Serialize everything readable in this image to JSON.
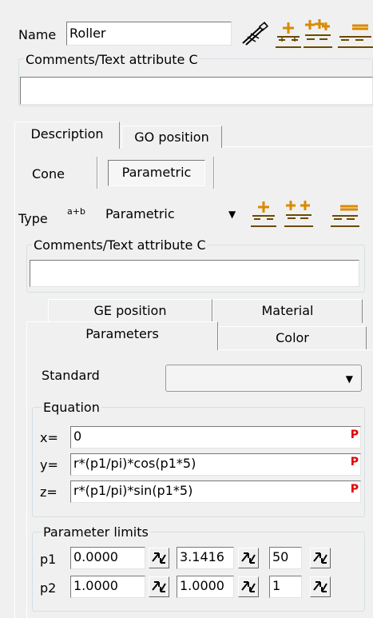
{
  "top": {
    "name_label": "Name",
    "name_value": "Roller",
    "comments_legend": "Comments/Text attribute C",
    "comments_value": ""
  },
  "tabs": [
    {
      "label": "Description",
      "active": true
    },
    {
      "label": "GO position",
      "active": false
    }
  ],
  "subtabs": [
    {
      "label": "Cone",
      "active": false
    },
    {
      "label": "Parametric",
      "active": true
    }
  ],
  "type_row": {
    "label": "Type",
    "badge": "a+b",
    "value": "Parametric"
  },
  "inner_comments": {
    "legend": "Comments/Text attribute C",
    "value": ""
  },
  "prop_tabs": {
    "row1": [
      "GE position",
      "Material"
    ],
    "row2": [
      "Parameters",
      "Color"
    ],
    "active": "Parameters"
  },
  "standard": {
    "label": "Standard",
    "value": ""
  },
  "equation": {
    "legend": "Equation",
    "marker": "P",
    "rows": [
      {
        "label": "x=",
        "value": "0"
      },
      {
        "label": "y=",
        "value": "r*(p1/pi)*cos(p1*5)"
      },
      {
        "label": "z=",
        "value": "r*(p1/pi)*sin(p1*5)"
      }
    ]
  },
  "limits": {
    "legend": "Parameter limits",
    "rows": [
      {
        "label": "p1",
        "min": "0.0000",
        "max": "3.1416",
        "steps": "50"
      },
      {
        "label": "p2",
        "min": "1.0000",
        "max": "1.0000",
        "steps": "1"
      }
    ]
  },
  "colors": {
    "window_bg": "#f0f0f0",
    "icon_orange": "#d98a00",
    "icon_brown": "#6b4a00",
    "p_marker": "#e00000"
  }
}
